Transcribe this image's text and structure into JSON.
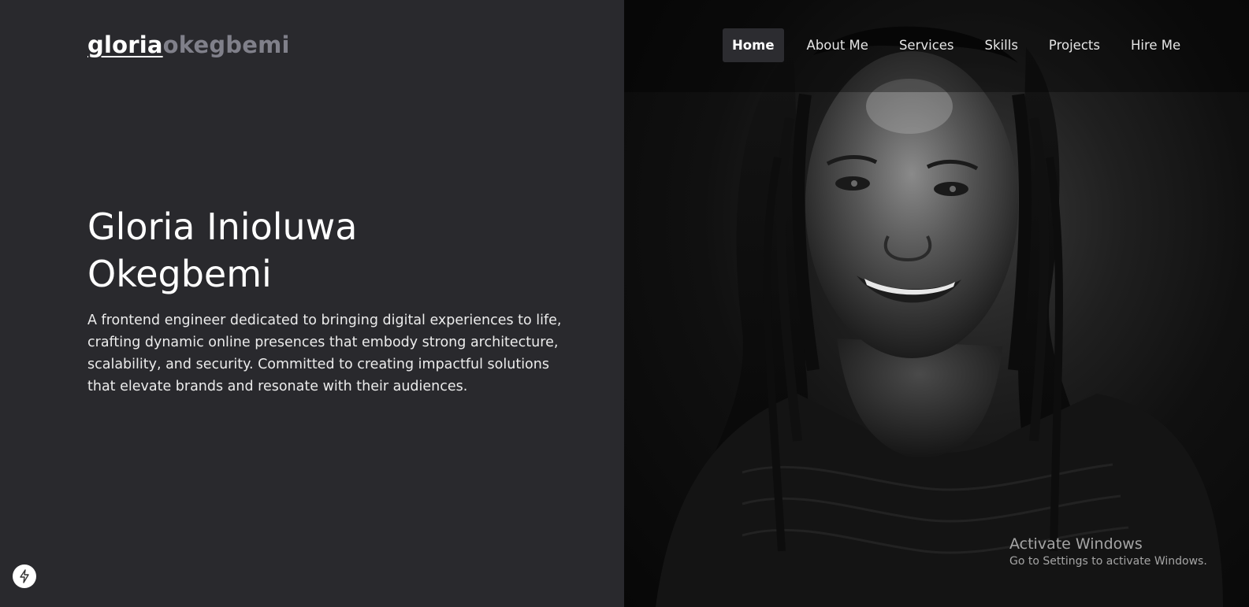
{
  "logo": {
    "first": "gloria",
    "last": "okegbemi"
  },
  "nav": {
    "items": [
      {
        "label": "Home",
        "active": true
      },
      {
        "label": "About Me",
        "active": false
      },
      {
        "label": "Services",
        "active": false
      },
      {
        "label": "Skills",
        "active": false
      },
      {
        "label": "Projects",
        "active": false
      },
      {
        "label": "Hire Me",
        "active": false
      }
    ]
  },
  "hero": {
    "name_line1": "Gloria Inioluwa",
    "name_line2": "Okegbemi",
    "description": "A frontend engineer dedicated to bringing digital experiences to life, crafting dynamic online presences that embody strong architecture, scalability, and security. Committed to creating impactful solutions that elevate brands and resonate with their audiences."
  },
  "watermark": {
    "title": "Activate Windows",
    "subtitle": "Go to Settings to activate Windows."
  },
  "icons": {
    "bolt": "lightning-bolt-icon"
  },
  "colors": {
    "background": "#29292d",
    "logo_accent": "#80808a",
    "nav_active_bg": "#2c2c30",
    "text": "#ffffff"
  }
}
